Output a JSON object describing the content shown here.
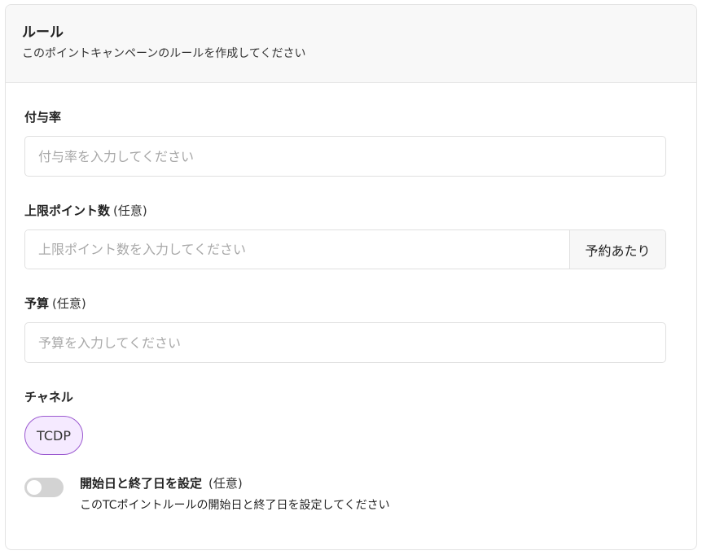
{
  "header": {
    "title": "ルール",
    "subtitle": "このポイントキャンペーンのルールを作成してください"
  },
  "fields": {
    "rate": {
      "label": "付与率",
      "placeholder": "付与率を入力してください",
      "value": ""
    },
    "max_points": {
      "label": "上限ポイント数",
      "optional": "(任意)",
      "placeholder": "上限ポイント数を入力してください",
      "value": "",
      "addon": "予約あたり"
    },
    "budget": {
      "label": "予算",
      "optional": "(任意)",
      "placeholder": "予算を入力してください",
      "value": ""
    },
    "channel": {
      "label": "チャネル",
      "chips": [
        "TCDP"
      ]
    }
  },
  "schedule": {
    "title": "開始日と終了日を設定",
    "optional": "(任意)",
    "description": "このTCポイントルールの開始日と終了日を設定してください",
    "enabled": false
  },
  "colors": {
    "chip_border": "#9b59d0",
    "chip_bg": "#f5eaff",
    "toggle_off": "#d3d3d3"
  }
}
